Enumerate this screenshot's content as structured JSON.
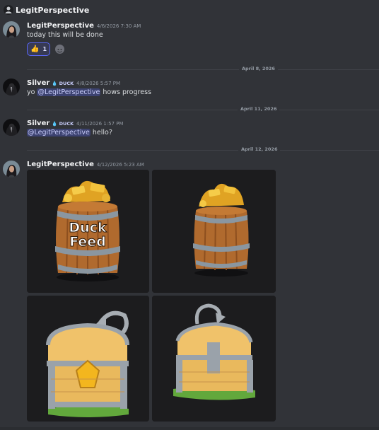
{
  "channel": {
    "title": "LegitPerspective"
  },
  "messages": [
    {
      "author": "LegitPerspective",
      "timestamp": "4/6/2026 7:30 AM",
      "text": "today this will be done",
      "reaction": {
        "emoji": "👍",
        "count": "1"
      }
    },
    {
      "author": "Silver",
      "tag": "DUCK",
      "timestamp": "4/8/2026 5:57 PM",
      "pre": "yo ",
      "mention": "@LegitPerspective",
      "post": " hows progress"
    },
    {
      "author": "Silver",
      "tag": "DUCK",
      "timestamp": "4/11/2026 1:57 PM",
      "pre": "",
      "mention": "@LegitPerspective",
      "post": " hello?"
    },
    {
      "author": "LegitPerspective",
      "timestamp": "4/12/2026 5:23 AM",
      "attachments": [
        {
          "label": "Duck Feed",
          "line1": "Duck",
          "line2": "Feed"
        },
        {
          "label": ""
        },
        {
          "label": ""
        },
        {
          "label": ""
        }
      ]
    }
  ],
  "dividers": [
    "April 8, 2026",
    "April 11, 2026",
    "April 12, 2026"
  ],
  "colors": {
    "accent": "#5865f2",
    "mention_bg": "#3c4270",
    "background": "#313338",
    "text": "#dbdee1"
  },
  "icons": [
    "channel-icon",
    "thumbs-up-emoji",
    "add-reaction-icon",
    "duck-drop-icon"
  ]
}
